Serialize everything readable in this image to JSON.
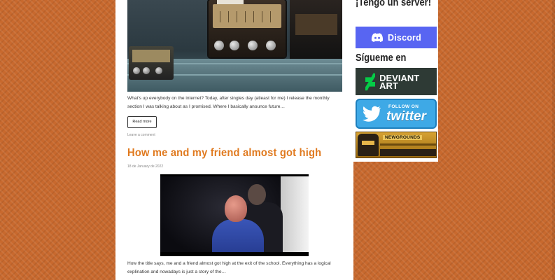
{
  "post1": {
    "excerpt": "What's up everybody on the internet? Today, after singles day (atleast for me) I release the monthly section I was talking about as I promised. Where I basically anounce future…",
    "read_more": "Read more",
    "comment_link": "Leave a comment"
  },
  "post2": {
    "title": "How me and my friend almost got high",
    "date": "18 de January de 2022",
    "excerpt": "How the title says, me and a friend almost got high at the exit of the school. Everything has a logical explination and nowadays is just a story of the…"
  },
  "sidebar": {
    "server_heading": "¡Tengo un server!",
    "discord_label": "Discord",
    "follow_heading": "Sígueme en",
    "deviantart_label": "DEVIANT ART",
    "twitter_small": "FOLLOW ON",
    "twitter_big": "twitter",
    "newgrounds_label": "NEWGROUNDS"
  },
  "colors": {
    "accent": "#e07a1f",
    "discord": "#5865f2",
    "twitter": "#3ea9e6",
    "background": "#c8692e"
  }
}
